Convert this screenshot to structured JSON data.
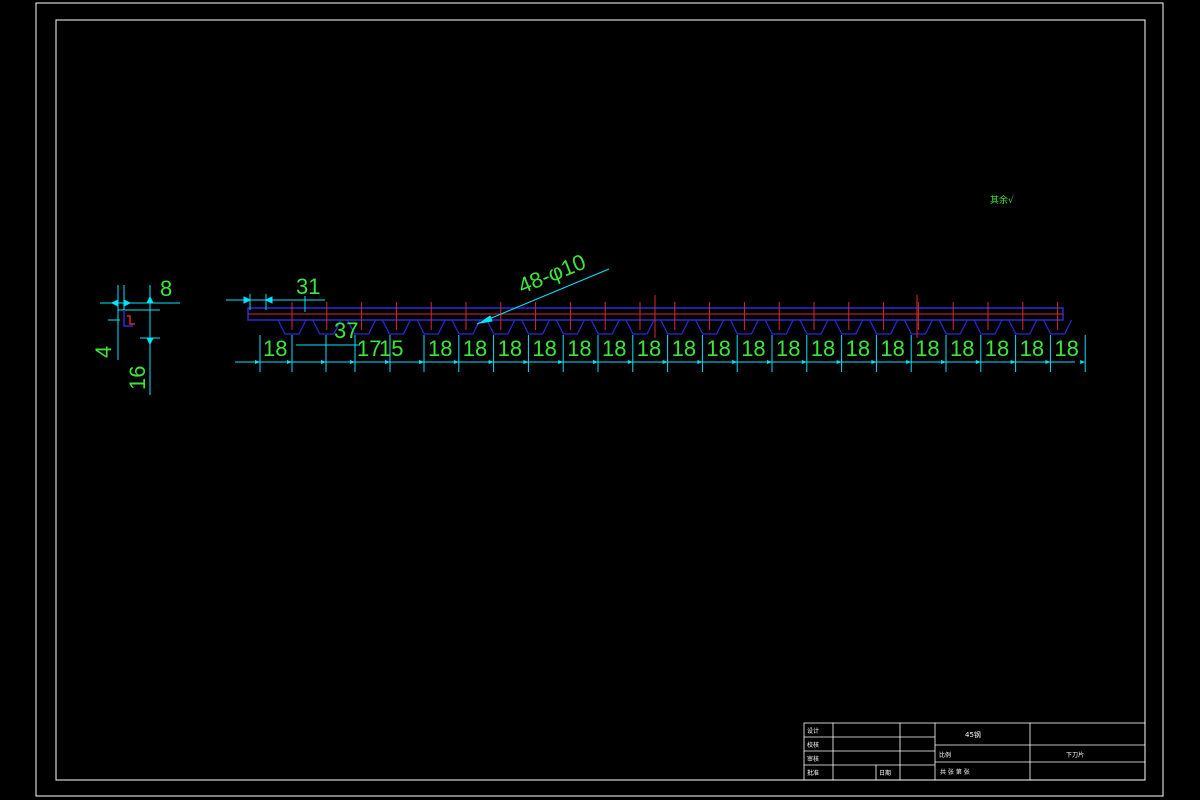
{
  "drawing": {
    "dimensions": {
      "top_width": "31",
      "flange_height": "8",
      "lip": "4",
      "depth": "16",
      "first_pitch": "37",
      "hole_callout": "48-φ10",
      "start_offset": "18",
      "mid_small_a": "17",
      "mid_small_b": "15",
      "pitch_label": "18",
      "pitch_values": [
        "18",
        "18",
        "18",
        "18",
        "18",
        "18",
        "18",
        "18",
        "18",
        "18",
        "18",
        "18",
        "18",
        "18",
        "18",
        "18",
        "18",
        "18",
        "18"
      ]
    },
    "roughness_symbol": "其余√"
  },
  "title_block": {
    "rows": {
      "designer": "设计",
      "checker": "校核",
      "reviewer": "审核",
      "approver": "批准",
      "date_label": "日期"
    },
    "material": "45钢",
    "scale_label": "比例",
    "part_name": "下刀片",
    "sheet_info": "共  张  第  张"
  },
  "colors": {
    "background": "#000000",
    "frame": "#ffffff",
    "dimension": "#00e5ff",
    "dimension_text": "#39e639",
    "outline": "#2b2bd6",
    "centerline": "#d62b2b"
  }
}
